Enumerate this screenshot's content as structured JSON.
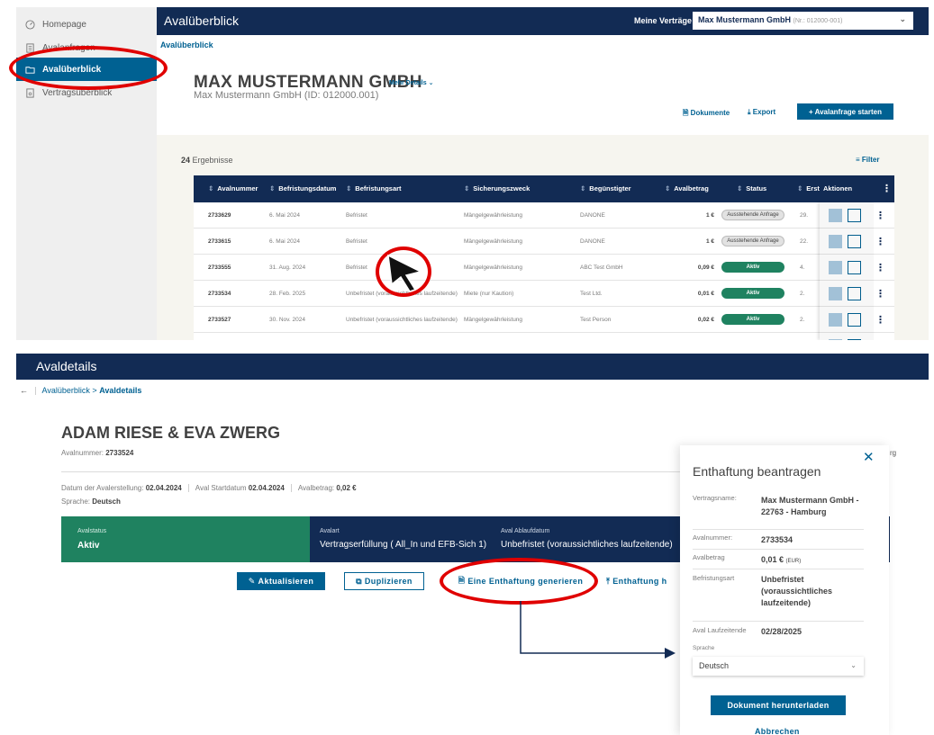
{
  "sidebar": {
    "items": [
      {
        "label": "Homepage",
        "icon": "gauge-icon"
      },
      {
        "label": "Avalanfragen",
        "icon": "document-icon"
      },
      {
        "label": "Avalüberblick",
        "icon": "folder-icon",
        "active": true
      },
      {
        "label": "Vertragsüberblick",
        "icon": "contract-icon"
      }
    ]
  },
  "topbar": {
    "title": "Avalüberblick",
    "contracts_label": "Meine Verträge",
    "contract_value": "Max Mustermann GmbH",
    "contract_nr": "(Nr.: 012000-001)"
  },
  "overview": {
    "breadcrumb": "Avalüberblick",
    "customer_name": "MAX MUSTERMANN GMBH",
    "more_details": "Mehr Details",
    "customer_id": "Max Mustermann GmbH (ID: 012000.001)",
    "documents_label": "Dokumente",
    "export_label": "Export",
    "start_label": "+ Avalanfrage starten",
    "result_count": "24",
    "result_suffix": "Ergebnisse",
    "filter_label": "Filter"
  },
  "table": {
    "columns": [
      "Avalnummer",
      "Befristungsdatum",
      "Befristungsart",
      "Sicherungszweck",
      "Begünstigter",
      "Avalbetrag",
      "Status",
      "Erst",
      "Aktionen"
    ],
    "rows": [
      {
        "nr": "2733629",
        "date": "6. Mai 2024",
        "type": "Befristet",
        "purpose": "Mängelgewährleistung",
        "beneficiary": "DANONE",
        "amount": "1 €",
        "status": "Ausstehende Anfrage",
        "status_kind": "pending",
        "erst": "29."
      },
      {
        "nr": "2733615",
        "date": "6. Mai 2024",
        "type": "Befristet",
        "purpose": "Mängelgewährleistung",
        "beneficiary": "DANONE",
        "amount": "1 €",
        "status": "Ausstehende Anfrage",
        "status_kind": "pending",
        "erst": "22."
      },
      {
        "nr": "2733555",
        "date": "31. Aug. 2024",
        "type": "Befristet",
        "purpose": "Mängelgewährleistung",
        "beneficiary": "ABC Test GmbH",
        "amount": "0,09 €",
        "status": "Aktiv",
        "status_kind": "active",
        "erst": "4."
      },
      {
        "nr": "2733534",
        "date": "28. Feb. 2025",
        "type": "Unbefristet (voraussichtliches laufzeitende)",
        "purpose": "Miete (nur Kaution)",
        "beneficiary": "Test Ltd.",
        "amount": "0,01 €",
        "status": "Aktiv",
        "status_kind": "active",
        "erst": "2."
      },
      {
        "nr": "2733527",
        "date": "30. Nov. 2024",
        "type": "Unbefristet (voraussichtliches laufzeitende)",
        "purpose": "Mängelgewährleistung",
        "beneficiary": "Test Person",
        "amount": "0,02 €",
        "status": "Aktiv",
        "status_kind": "active",
        "erst": "2."
      },
      {
        "nr": "",
        "date": "",
        "type": "",
        "purpose": "",
        "beneficiary": "",
        "amount": "",
        "status": "",
        "status_kind": "active",
        "erst": ""
      }
    ]
  },
  "details": {
    "header_title": "Avaldetails",
    "crumb_parent": "Avalüberblick",
    "crumb_sep": ">",
    "crumb_current": "Avaldetails",
    "name": "ADAM RIESE & EVA ZWERG",
    "avalnummer_label": "Avalnummer:",
    "avalnummer": "2733524",
    "created_label": "Datum der Avalerstellung:",
    "created": "02.04.2024",
    "start_label": "Aval Startdatum",
    "start": "02.04.2024",
    "amount_label": "Avalbetrag:",
    "amount": "0,02 €",
    "lang_label": "Sprache:",
    "lang": "Deutsch",
    "status_label": "Avalstatus",
    "status": "Aktiv",
    "type_label": "Avalart",
    "type": "Vertragserfüllung ( All_In und EFB-Sich 1)",
    "end_label": "Aval Ablaufdatum",
    "end": "Unbefristet (voraussichtliches laufzeitende)",
    "btn_update": "Aktualisieren",
    "btn_duplicate": "Duplizieren",
    "btn_generate": "Eine Enthaftung generieren",
    "btn_enthaftung": "Enthaftung h",
    "peek_text": "rg"
  },
  "modal": {
    "title": "Enthaftung beantragen",
    "contract_label": "Vertragsname:",
    "contract": "Max Mustermann GmbH - 22763 - Hamburg",
    "avalnummer_label": "Avalnummer:",
    "avalnummer": "2733534",
    "amount_label": "Avalbetrag",
    "amount": "0,01 €",
    "amount_currency": "(EUR)",
    "type_label": "Befristungsart",
    "type": "Unbefristet (voraussichtliches laufzeitende)",
    "end_label": "Aval Laufzeitende",
    "end": "02/28/2025",
    "lang_label": "Sprache",
    "lang": "Deutsch",
    "download": "Dokument herunterladen",
    "cancel": "Abbrechen"
  },
  "colors": {
    "navy": "#122b54",
    "blue": "#006192",
    "green": "#1f8260",
    "highlight_red": "#e00000"
  }
}
